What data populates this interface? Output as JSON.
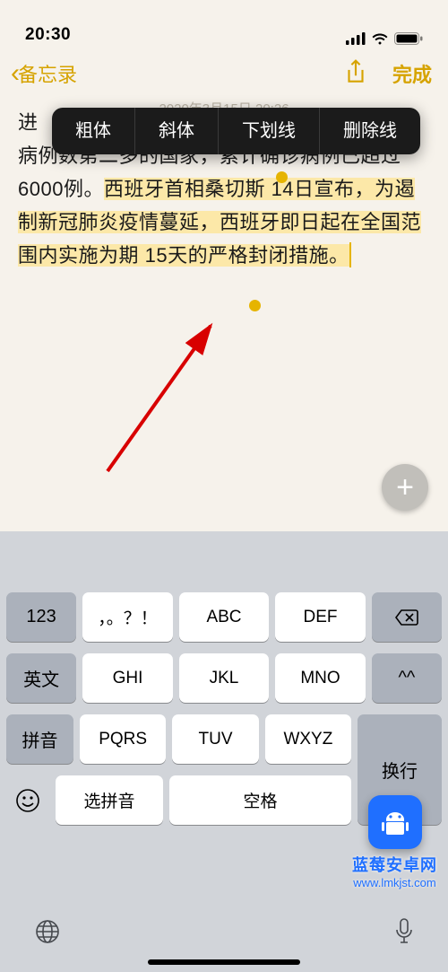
{
  "status": {
    "time": "20:30"
  },
  "nav": {
    "back": "备忘录",
    "done": "完成"
  },
  "date_header": "2020年3月15日 20:26",
  "popover": {
    "bold": "粗体",
    "italic": "斜体",
    "underline": "下划线",
    "strike": "删除线"
  },
  "note": {
    "part1_before_popover": "进",
    "part1_after_popover": "地区新冠肺炎确诊病例数第二多的国家，累计确诊病例已超过 6000例。",
    "highlighted": "西班牙首相桑切斯 14日宣布，为遏制新冠肺炎疫情蔓延，西班牙即日起在全国范围内实施为期 15天的严格封闭措施。"
  },
  "fab": "+",
  "keyboard": {
    "row1": [
      "123",
      "，。？！",
      "ABC",
      "DEF"
    ],
    "row2": [
      "英文",
      "GHI",
      "JKL",
      "MNO",
      "^^"
    ],
    "row3": [
      "拼音",
      "PQRS",
      "TUV",
      "WXYZ"
    ],
    "enter": "换行",
    "emoji": "☻",
    "select_pinyin": "选拼音",
    "space": "空格"
  },
  "watermark": {
    "name": "蓝莓安卓网",
    "url": "www.lmkjst.com"
  }
}
